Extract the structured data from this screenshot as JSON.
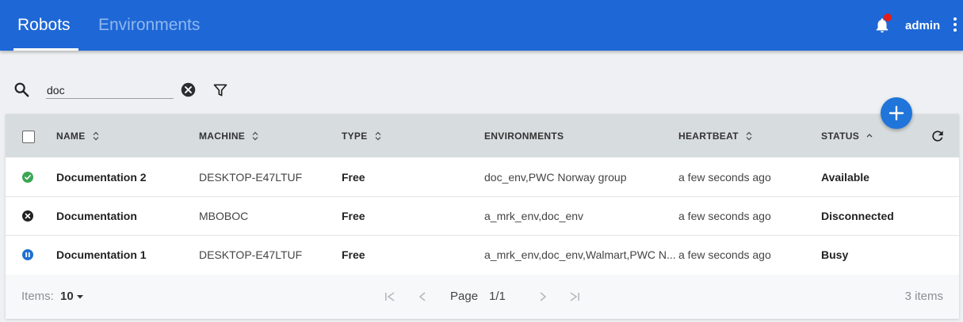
{
  "header": {
    "tabs": [
      {
        "label": "Robots",
        "active": true
      },
      {
        "label": "Environments",
        "active": false
      }
    ],
    "user": "admin",
    "accent": "#1e67d6"
  },
  "toolbar": {
    "search_value": "doc",
    "icons": [
      "search-icon",
      "clear-icon",
      "filter-icon",
      "plus-icon"
    ]
  },
  "table": {
    "columns": [
      "NAME",
      "MACHINE",
      "TYPE",
      "ENVIRONMENTS",
      "HEARTBEAT",
      "STATUS"
    ],
    "rows": [
      {
        "status_icon": "check-circle-icon",
        "name": "Documentation 2",
        "machine": "DESKTOP-E47LTUF",
        "type": "Free",
        "environments": "doc_env,PWC Norway group",
        "heartbeat": "a few seconds ago",
        "status": "Available"
      },
      {
        "status_icon": "x-circle-icon",
        "name": "Documentation",
        "machine": "MBOBOC",
        "type": "Free",
        "environments": "a_mrk_env,doc_env",
        "heartbeat": "a few seconds ago",
        "status": "Disconnected"
      },
      {
        "status_icon": "pause-circle-icon",
        "name": "Documentation 1",
        "machine": "DESKTOP-E47LTUF",
        "type": "Free",
        "environments": "a_mrk_env,doc_env,Walmart,PWC N...",
        "heartbeat": "a few seconds ago",
        "status": "Busy"
      }
    ]
  },
  "footer": {
    "items_label": "Items:",
    "items_value": "10",
    "page_label": "Page",
    "page_value": "1/1",
    "total": "3 items"
  },
  "colors": {
    "available": "#3aa655",
    "disconnected": "#222222",
    "busy": "#1f6fd1"
  }
}
